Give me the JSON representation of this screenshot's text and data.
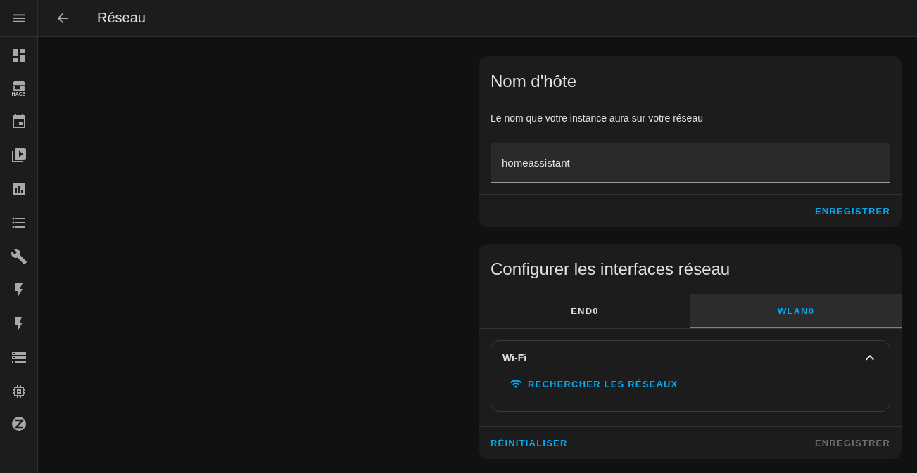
{
  "sidebar": {
    "store_caption": "HACS"
  },
  "header": {
    "title": "Réseau"
  },
  "hostname_card": {
    "title": "Nom d'hôte",
    "description": "Le nom que votre instance aura sur votre réseau",
    "value": "homeassistant",
    "save": {
      "label": "ENREGISTRER",
      "disabled": false
    }
  },
  "interfaces_card": {
    "title": "Configurer les interfaces réseau",
    "tabs": [
      {
        "label": "END0",
        "selected": false
      },
      {
        "label": "WLAN0",
        "selected": true
      }
    ],
    "wifi": {
      "title": "Wi-Fi",
      "expanded": true,
      "scan": "RECHERCHER LES RÉSEAUX"
    },
    "reset": {
      "label": "RÉINITIALISER",
      "disabled": false
    },
    "save": {
      "label": "ENREGISTRER",
      "disabled": true
    }
  }
}
